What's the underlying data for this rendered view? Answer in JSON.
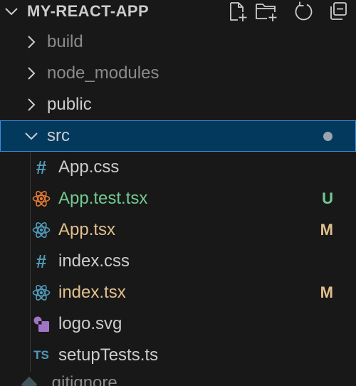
{
  "explorer": {
    "title": "MY-REACT-APP",
    "actions": [
      "new-file-icon",
      "new-folder-icon",
      "refresh-icon",
      "collapse-all-icon"
    ],
    "folders": [
      {
        "label": "build",
        "color": "#8b8b8b",
        "expanded": false
      },
      {
        "label": "node_modules",
        "color": "#8b8b8b",
        "expanded": false
      },
      {
        "label": "public",
        "color": "#cccccc",
        "expanded": false
      },
      {
        "label": "src",
        "color": "#cccccc",
        "expanded": true,
        "selected": true,
        "modified_dot": true
      }
    ],
    "files": [
      {
        "label": "App.css",
        "icon": "css-hash-icon",
        "color": "#cccccc",
        "decoration": ""
      },
      {
        "label": "App.test.tsx",
        "icon": "react-test-icon",
        "color": "#73c991",
        "decoration": "U"
      },
      {
        "label": "App.tsx",
        "icon": "react-icon",
        "color": "#e2c08d",
        "decoration": "M"
      },
      {
        "label": "index.css",
        "icon": "css-hash-icon",
        "color": "#cccccc",
        "decoration": ""
      },
      {
        "label": "index.tsx",
        "icon": "react-icon",
        "color": "#e2c08d",
        "decoration": "M"
      },
      {
        "label": "logo.svg",
        "icon": "svg-shapes-icon",
        "color": "#cccccc",
        "decoration": ""
      },
      {
        "label": "setupTests.ts",
        "icon": "ts-icon",
        "color": "#cccccc",
        "decoration": ""
      }
    ],
    "partial_file": {
      "label": ".gitignore",
      "icon": "git-icon"
    },
    "ts_icon_text": "TS",
    "css_icon_text": "#"
  },
  "colors": {
    "background": "#181818",
    "selection_bg": "#04395e",
    "selection_border": "#3b8edb",
    "untracked": "#73c991",
    "modified": "#e2c08d",
    "css_icon": "#519aba",
    "react_icon": "#519aba",
    "test_icon": "#e37933",
    "svg_icon": "#a074c4",
    "ts_icon": "#519aba"
  }
}
